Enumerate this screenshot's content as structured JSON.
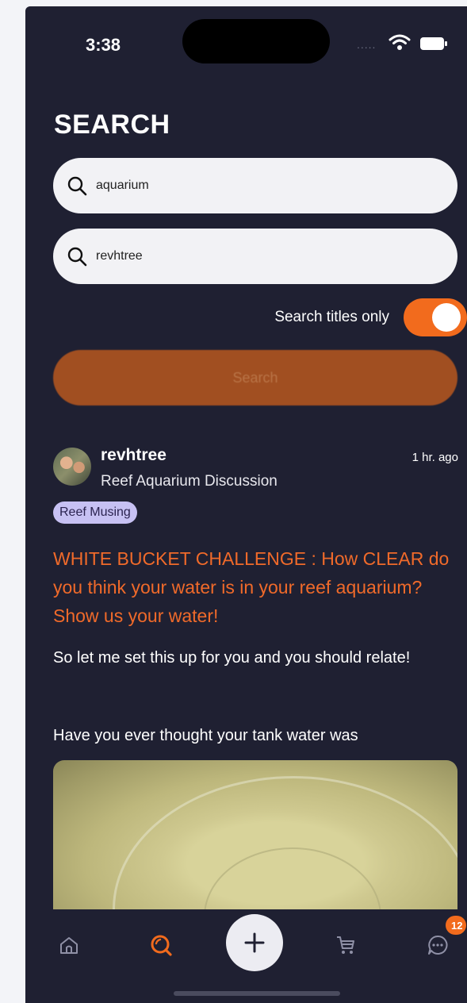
{
  "status_bar": {
    "time": "3:38"
  },
  "page": {
    "title": "SEARCH"
  },
  "search": {
    "query_value": "aquarium",
    "user_value": "revhtree",
    "titles_only_label": "Search titles only",
    "titles_only_on": true,
    "search_button_label": "Search"
  },
  "result": {
    "username": "revhtree",
    "time": "1 hr. ago",
    "forum": "Reef Aquarium Discussion",
    "tag": "Reef Musing",
    "title": "WHITE BUCKET CHALLENGE : How CLEAR do you think your water is in your reef aquarium? Show us your water!",
    "body_line1": "So let me set this up for you and you should relate!",
    "body_line2": "Have you ever thought your tank water was"
  },
  "tabbar": {
    "items": [
      "home-icon",
      "search-icon",
      "plus-icon",
      "cart-icon",
      "chat-icon"
    ],
    "active": "search",
    "chat_badge": "12"
  },
  "colors": {
    "background": "#1f2032",
    "accent": "#f26b1d",
    "tag_bg": "#c7c1f3",
    "title_color": "#f06a2a"
  }
}
